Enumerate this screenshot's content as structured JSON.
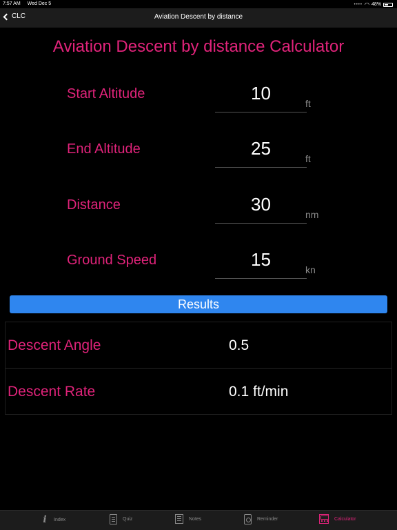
{
  "status_bar": {
    "time": "7:57 AM",
    "date": "Wed Dec 5",
    "battery": "48%"
  },
  "nav": {
    "back_label": "CLC",
    "title": "Aviation Descent by distance"
  },
  "page_title": "Aviation Descent by distance Calculator",
  "fields": [
    {
      "label": "Start Altitude",
      "value": "10",
      "unit": "ft"
    },
    {
      "label": "End Altitude",
      "value": "25",
      "unit": "ft"
    },
    {
      "label": "Distance",
      "value": "30",
      "unit": "nm"
    },
    {
      "label": "Ground Speed",
      "value": "15",
      "unit": "kn"
    }
  ],
  "results_button": "Results",
  "results": [
    {
      "label": "Descent Angle",
      "value": "0.5"
    },
    {
      "label": "Descent Rate",
      "value": "0.1 ft/min"
    }
  ],
  "tabs": [
    {
      "label": "Index",
      "icon": "info-icon"
    },
    {
      "label": "Quiz",
      "icon": "quiz-icon"
    },
    {
      "label": "Notes",
      "icon": "notes-icon"
    },
    {
      "label": "Reminder",
      "icon": "reminder-icon"
    },
    {
      "label": "Calculator",
      "icon": "calculator-icon",
      "active": true
    }
  ],
  "colors": {
    "accent": "#e0237a",
    "button": "#2f86ef",
    "background": "#000000"
  }
}
